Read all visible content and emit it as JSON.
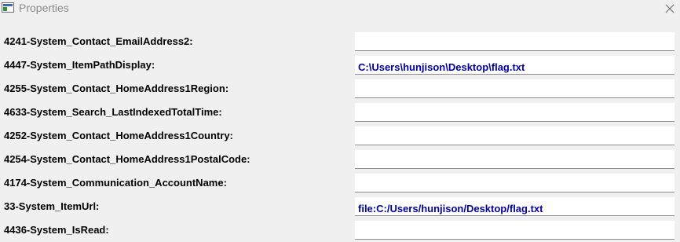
{
  "window": {
    "title": "Properties"
  },
  "properties": [
    {
      "label": "4241-System_Contact_EmailAddress2:",
      "value": ""
    },
    {
      "label": "4447-System_ItemPathDisplay:",
      "value": "C:\\Users\\hunjison\\Desktop\\flag.txt"
    },
    {
      "label": "4255-System_Contact_HomeAddress1Region:",
      "value": ""
    },
    {
      "label": "4633-System_Search_LastIndexedTotalTime:",
      "value": ""
    },
    {
      "label": "4252-System_Contact_HomeAddress1Country:",
      "value": ""
    },
    {
      "label": "4254-System_Contact_HomeAddress1PostalCode:",
      "value": ""
    },
    {
      "label": "4174-System_Communication_AccountName:",
      "value": ""
    },
    {
      "label": "33-System_ItemUrl:",
      "value": "file:C:/Users/hunjison/Desktop/flag.txt"
    },
    {
      "label": "4436-System_IsRead:",
      "value": ""
    }
  ],
  "colors": {
    "value_text": "#0000a0",
    "background": "#f0f0f0"
  }
}
